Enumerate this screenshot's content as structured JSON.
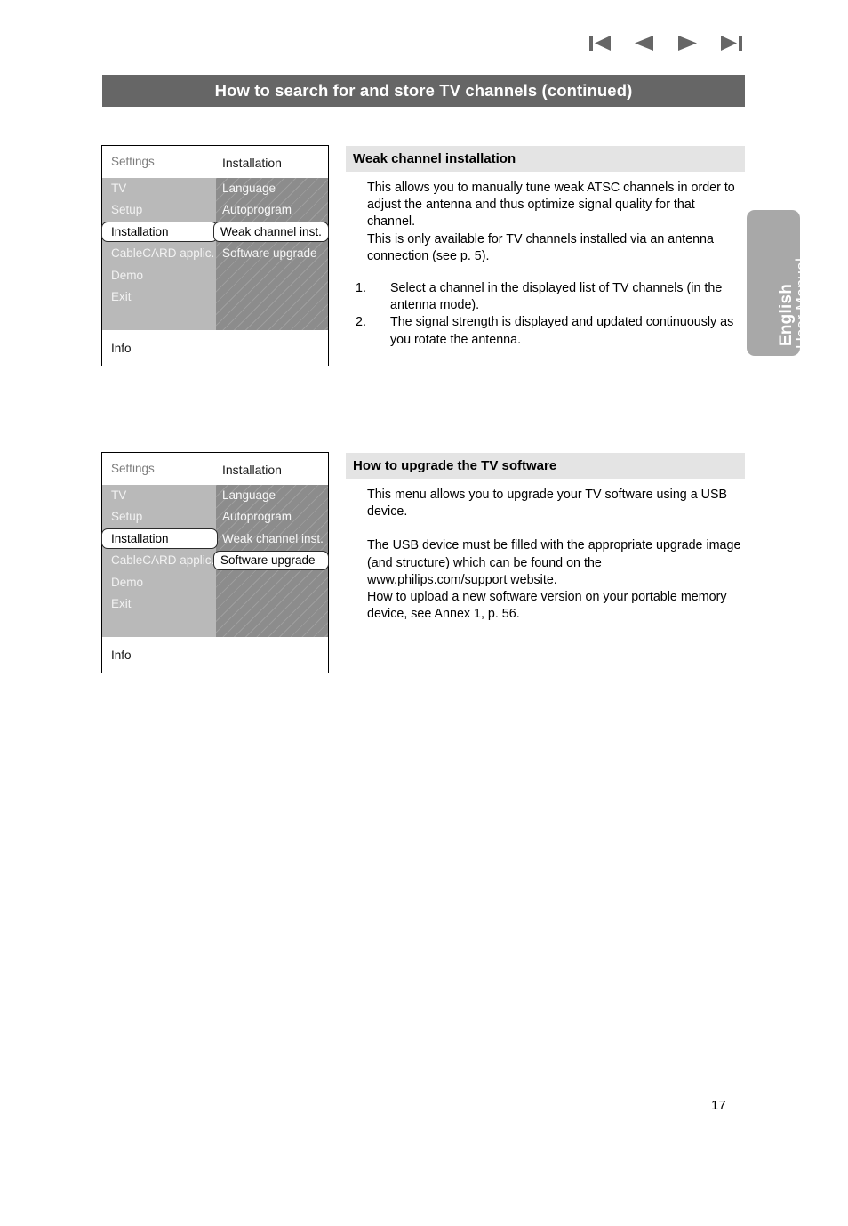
{
  "nav": {
    "icons": [
      {
        "name": "first-page-icon",
        "label": "First"
      },
      {
        "name": "previous-page-icon",
        "label": "Previous"
      },
      {
        "name": "next-page-icon",
        "label": "Next"
      },
      {
        "name": "last-page-icon",
        "label": "Last"
      }
    ]
  },
  "header": {
    "title": "How to search for and store TV channels (continued)",
    "background": "#666666",
    "text_color": "#ffffff"
  },
  "side_tab": {
    "language": "English",
    "manual": "User Manual",
    "background": "#a8a8a8"
  },
  "osd_menus": [
    {
      "settings_label": "Settings",
      "submenu_label": "Installation",
      "info_label": "Info",
      "rows": [
        {
          "left": "TV",
          "right": "Language"
        },
        {
          "left": "Setup",
          "right": "Autoprogram"
        },
        {
          "left": "Installation",
          "right": "Weak channel inst."
        },
        {
          "left": "CableCARD applic.",
          "right": "Software upgrade"
        },
        {
          "left": "Demo",
          "right": ""
        },
        {
          "left": "Exit",
          "right": ""
        },
        {
          "left": "",
          "right": ""
        }
      ],
      "selected_left_index": 2,
      "selected_right_index": 2
    },
    {
      "settings_label": "Settings",
      "submenu_label": "Installation",
      "info_label": "Info",
      "rows": [
        {
          "left": "TV",
          "right": "Language"
        },
        {
          "left": "Setup",
          "right": "Autoprogram"
        },
        {
          "left": "Installation",
          "right": "Weak channel inst."
        },
        {
          "left": "CableCARD applic.",
          "right": "Software upgrade"
        },
        {
          "left": "Demo",
          "right": ""
        },
        {
          "left": "Exit",
          "right": ""
        },
        {
          "left": "",
          "right": ""
        }
      ],
      "selected_left_index": 2,
      "selected_right_index": 3
    }
  ],
  "sections": [
    {
      "heading": "Weak channel installation",
      "paragraph1": "This allows you to manually tune weak ATSC channels in order to adjust the antenna and thus optimize signal quality for that channel.",
      "paragraph2": "This is only available for TV channels installed via an antenna connection (see p. 5).",
      "steps": [
        {
          "num": "1.",
          "text": "Select a channel in the displayed list of TV channels (in the antenna mode)."
        },
        {
          "num": "2.",
          "text": "The signal strength is displayed and updated continuously as you rotate the antenna."
        }
      ]
    },
    {
      "heading": "How to upgrade the TV software",
      "paragraph1": "This menu allows you to upgrade your TV software using a USB device.",
      "paragraph2": "The USB device must be filled with the appropriate upgrade image (and structure) which can be found on the www.philips.com/support website.",
      "paragraph3": "How to upload a new software version on your portable memory device, see Annex 1, p. 56."
    }
  ],
  "page_number": "17"
}
